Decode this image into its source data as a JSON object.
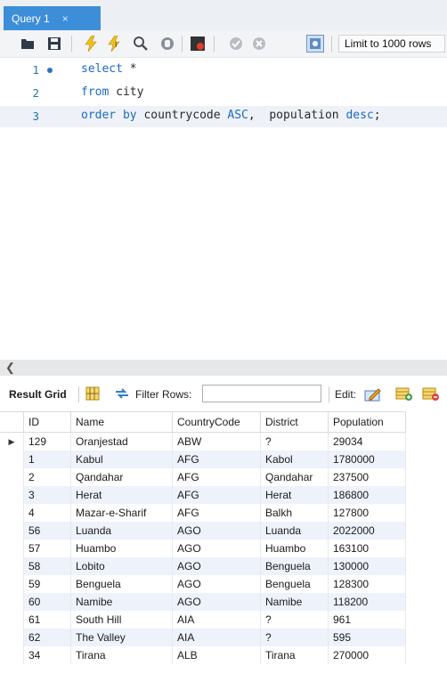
{
  "tab": {
    "label": "Query 1",
    "close": "×"
  },
  "toolbar": {
    "limit_label": "Limit to 1000 rows"
  },
  "editor": {
    "lines": [
      {
        "num": "1",
        "tokens": [
          {
            "t": "select",
            "k": true
          },
          {
            "t": " *",
            "k": false
          }
        ]
      },
      {
        "num": "2",
        "tokens": [
          {
            "t": "from",
            "k": true
          },
          {
            "t": " city",
            "k": false
          }
        ]
      },
      {
        "num": "3",
        "tokens": [
          {
            "t": "order by",
            "k": true
          },
          {
            "t": " countrycode ",
            "k": false
          },
          {
            "t": "ASC",
            "k": true
          },
          {
            "t": ",  population ",
            "k": false
          },
          {
            "t": "desc",
            "k": true
          },
          {
            "t": ";",
            "k": false
          }
        ]
      }
    ]
  },
  "result": {
    "title": "Result Grid",
    "filter_label": "Filter Rows:",
    "filter_value": "",
    "edit_label": "Edit:"
  },
  "grid": {
    "columns": [
      "ID",
      "Name",
      "CountryCode",
      "District",
      "Population"
    ],
    "rows": [
      [
        "129",
        "Oranjestad",
        "ABW",
        "?",
        "29034"
      ],
      [
        "1",
        "Kabul",
        "AFG",
        "Kabol",
        "1780000"
      ],
      [
        "2",
        "Qandahar",
        "AFG",
        "Qandahar",
        "237500"
      ],
      [
        "3",
        "Herat",
        "AFG",
        "Herat",
        "186800"
      ],
      [
        "4",
        "Mazar-e-Sharif",
        "AFG",
        "Balkh",
        "127800"
      ],
      [
        "56",
        "Luanda",
        "AGO",
        "Luanda",
        "2022000"
      ],
      [
        "57",
        "Huambo",
        "AGO",
        "Huambo",
        "163100"
      ],
      [
        "58",
        "Lobito",
        "AGO",
        "Benguela",
        "130000"
      ],
      [
        "59",
        "Benguela",
        "AGO",
        "Benguela",
        "128300"
      ],
      [
        "60",
        "Namibe",
        "AGO",
        "Namibe",
        "118200"
      ],
      [
        "61",
        "South Hill",
        "AIA",
        "?",
        "961"
      ],
      [
        "62",
        "The Valley",
        "AIA",
        "?",
        "595"
      ],
      [
        "34",
        "Tirana",
        "ALB",
        "Tirana",
        "270000"
      ]
    ],
    "current_row_marker": "▶"
  },
  "colors": {
    "accent": "#3d8ed8",
    "keyword": "#1c69c6",
    "row_alt": "#eef2fb"
  }
}
